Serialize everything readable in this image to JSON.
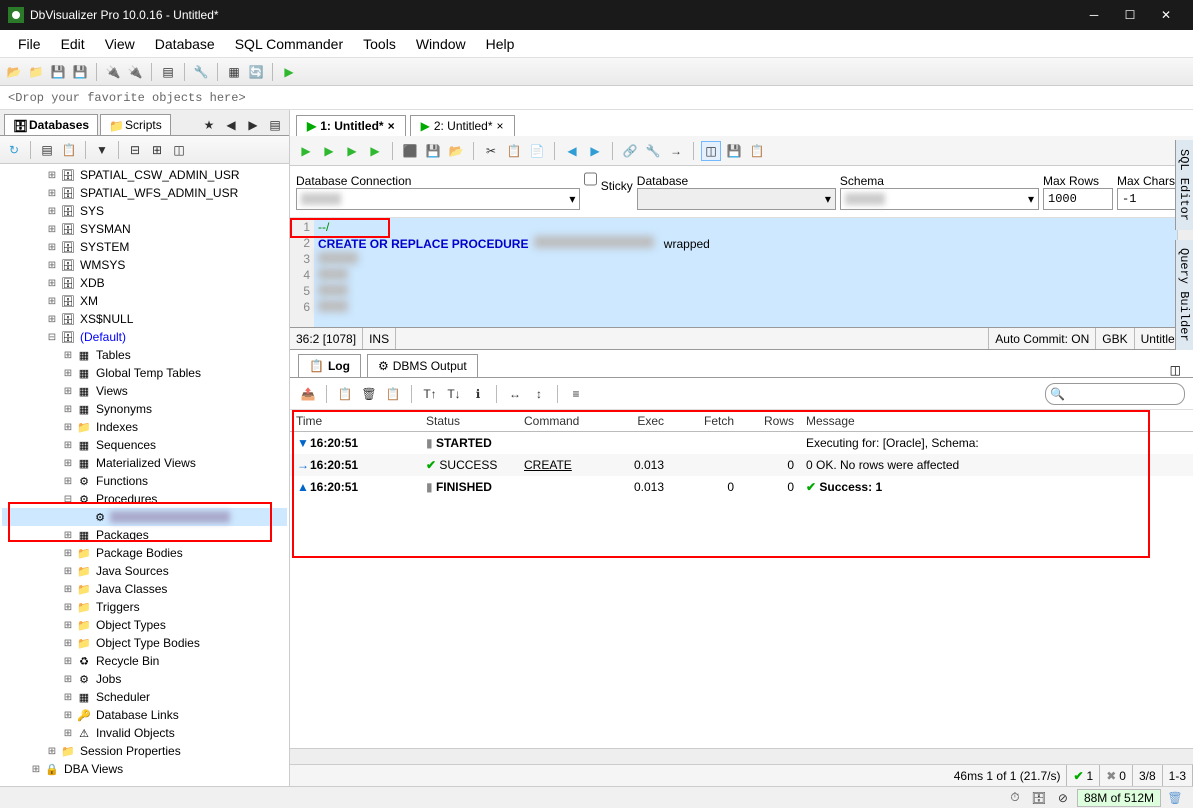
{
  "window": {
    "title": "DbVisualizer Pro 10.0.16 - Untitled*"
  },
  "menu": [
    "File",
    "Edit",
    "View",
    "Database",
    "SQL Commander",
    "Tools",
    "Window",
    "Help"
  ],
  "dropbar": "<Drop your favorite objects here>",
  "left": {
    "tabs": {
      "databases": "Databases",
      "scripts": "Scripts"
    },
    "tree": [
      {
        "d": 2,
        "exp": "+",
        "icon": "db",
        "lbl": "SPATIAL_CSW_ADMIN_USR",
        "trunc": true
      },
      {
        "d": 2,
        "exp": "+",
        "icon": "db",
        "lbl": "SPATIAL_WFS_ADMIN_USR"
      },
      {
        "d": 2,
        "exp": "+",
        "icon": "db",
        "lbl": "SYS"
      },
      {
        "d": 2,
        "exp": "+",
        "icon": "db",
        "lbl": "SYSMAN"
      },
      {
        "d": 2,
        "exp": "+",
        "icon": "db",
        "lbl": "SYSTEM"
      },
      {
        "d": 2,
        "exp": "+",
        "icon": "db",
        "lbl": "WMSYS"
      },
      {
        "d": 2,
        "exp": "+",
        "icon": "db",
        "lbl": "XDB"
      },
      {
        "d": 2,
        "exp": "+",
        "icon": "db",
        "lbl": "XM"
      },
      {
        "d": 2,
        "exp": "+",
        "icon": "db",
        "lbl": "XS$NULL"
      },
      {
        "d": 2,
        "exp": "-",
        "icon": "db",
        "lbl": "(Default)",
        "cls": "blue"
      },
      {
        "d": 3,
        "exp": "+",
        "icon": "tbl",
        "lbl": "Tables"
      },
      {
        "d": 3,
        "exp": "+",
        "icon": "tbl",
        "lbl": "Global Temp Tables"
      },
      {
        "d": 3,
        "exp": "+",
        "icon": "tbl",
        "lbl": "Views"
      },
      {
        "d": 3,
        "exp": "+",
        "icon": "tbl",
        "lbl": "Synonyms"
      },
      {
        "d": 3,
        "exp": "+",
        "icon": "fld",
        "lbl": "Indexes"
      },
      {
        "d": 3,
        "exp": "+",
        "icon": "tbl",
        "lbl": "Sequences"
      },
      {
        "d": 3,
        "exp": "+",
        "icon": "tbl",
        "lbl": "Materialized Views"
      },
      {
        "d": 3,
        "exp": "+",
        "icon": "gear",
        "lbl": "Functions"
      },
      {
        "d": 3,
        "exp": "-",
        "icon": "gear",
        "lbl": "Procedures"
      },
      {
        "d": 4,
        "exp": "",
        "icon": "gear",
        "lbl": "",
        "sel": true,
        "blur": true
      },
      {
        "d": 3,
        "exp": "+",
        "icon": "tbl",
        "lbl": "Packages"
      },
      {
        "d": 3,
        "exp": "+",
        "icon": "fld",
        "lbl": "Package Bodies"
      },
      {
        "d": 3,
        "exp": "+",
        "icon": "fld",
        "lbl": "Java Sources"
      },
      {
        "d": 3,
        "exp": "+",
        "icon": "fld",
        "lbl": "Java Classes"
      },
      {
        "d": 3,
        "exp": "+",
        "icon": "fld",
        "lbl": "Triggers"
      },
      {
        "d": 3,
        "exp": "+",
        "icon": "fld",
        "lbl": "Object Types"
      },
      {
        "d": 3,
        "exp": "+",
        "icon": "fld",
        "lbl": "Object Type Bodies"
      },
      {
        "d": 3,
        "exp": "+",
        "icon": "rec",
        "lbl": "Recycle Bin"
      },
      {
        "d": 3,
        "exp": "+",
        "icon": "gear",
        "lbl": "Jobs"
      },
      {
        "d": 3,
        "exp": "+",
        "icon": "tbl",
        "lbl": "Scheduler"
      },
      {
        "d": 3,
        "exp": "+",
        "icon": "key",
        "lbl": "Database Links"
      },
      {
        "d": 3,
        "exp": "+",
        "icon": "warn",
        "lbl": "Invalid Objects"
      },
      {
        "d": 2,
        "exp": "+",
        "icon": "fld",
        "lbl": "Session Properties"
      },
      {
        "d": 1,
        "exp": "+",
        "icon": "lock",
        "lbl": "DBA Views"
      }
    ]
  },
  "right": {
    "tabs": [
      {
        "label": "1: Untitled*",
        "active": true
      },
      {
        "label": "2: Untitled*",
        "active": false
      }
    ],
    "conn": {
      "dbconn_lbl": "Database Connection",
      "sticky_lbl": "Sticky",
      "database_lbl": "Database",
      "schema_lbl": "Schema",
      "maxrows_lbl": "Max Rows",
      "maxchars_lbl": "Max Chars",
      "maxrows_val": "1000",
      "maxchars_val": "-1"
    },
    "sql": {
      "lines": [
        "1",
        "2",
        "3",
        "4",
        "5",
        "6"
      ],
      "line1": "--/",
      "line2_kw": "CREATE OR REPLACE PROCEDURE",
      "line2_tail": " wrapped"
    },
    "cursorbar": {
      "pos": "36:2 [1078]",
      "ins": "INS",
      "autocommit": "Auto Commit: ON",
      "enc": "GBK",
      "file": "Untitled*"
    },
    "logtabs": {
      "log": "Log",
      "dbms": "DBMS Output"
    },
    "loghdr": [
      "Time",
      "Status",
      "Command",
      "Exec",
      "Fetch",
      "Rows",
      "Message"
    ],
    "logrows": [
      {
        "mark": "▼",
        "time": "16:20:51",
        "status": "STARTED",
        "statcls": "gray",
        "cmd": "",
        "exec": "",
        "fetch": "",
        "rows": "",
        "msg": "Executing for:       [Oracle], Schema:"
      },
      {
        "mark": "→",
        "time": "16:20:51",
        "status": "SUCCESS",
        "statcls": "ok",
        "cmd": "CREATE",
        "cmdlink": true,
        "exec": "0.013",
        "fetch": "",
        "rows": "0",
        "msg": "0 OK. No rows were affected"
      },
      {
        "mark": "▲",
        "time": "16:20:51",
        "status": "FINISHED",
        "statcls": "gray",
        "cmd": "",
        "exec": "0.013",
        "fetch": "0",
        "rows": "0",
        "msg": "Success: 1",
        "msgok": true
      }
    ],
    "bottom": {
      "timing": "46ms 1 of 1 (21.7/s)",
      "ok": "1",
      "err": "0",
      "pg": "3/8",
      "rng": "1-3"
    },
    "sidetabs": [
      "SQL Editor",
      "Query Builder"
    ]
  },
  "appstat": {
    "mem": "88M of 512M"
  }
}
